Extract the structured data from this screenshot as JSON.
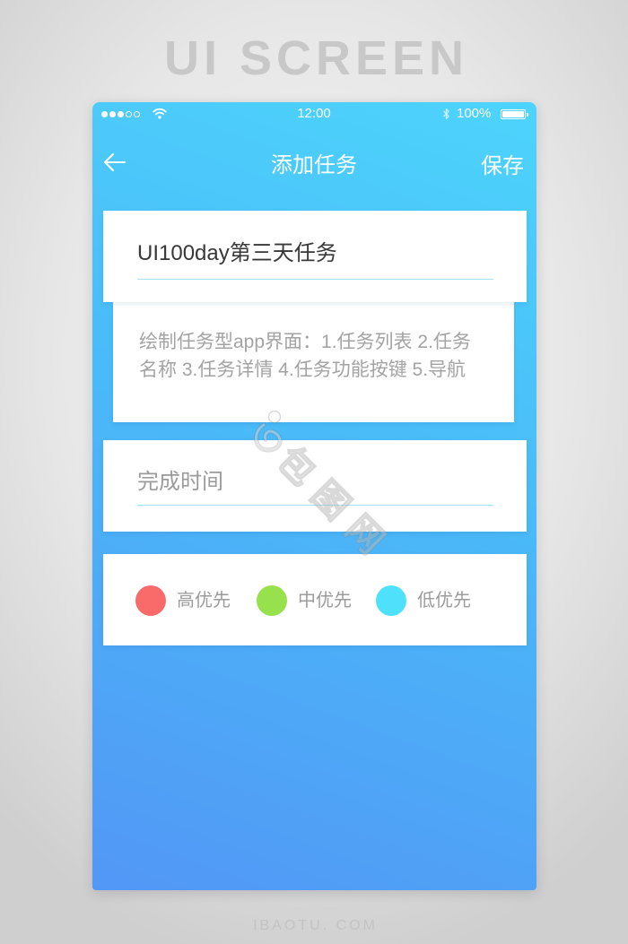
{
  "banner": {
    "title": "UI SCREEN"
  },
  "status_bar": {
    "signal_filled": 3,
    "signal_icon": "signal-dots-icon",
    "wifi_icon": "wifi-icon",
    "time": "12:00",
    "bluetooth_icon": "bluetooth-icon",
    "battery_text": "100%",
    "battery_icon": "battery-icon",
    "battery_level": 1.0
  },
  "nav": {
    "back_icon": "back-arrow-icon",
    "title": "添加任务",
    "save_label": "保存"
  },
  "form": {
    "task_name": "UI100day第三天任务",
    "description_lines": [
      "绘制任务型app界面：1.任务列表 2.任务",
      "名称 3.任务详情 4.任务功能按键 5.导航"
    ],
    "due_time_placeholder": "完成时间"
  },
  "priority": {
    "options": [
      {
        "label": "高优先",
        "color": "#f96b6b"
      },
      {
        "label": "中优先",
        "color": "#96e14c"
      },
      {
        "label": "低优先",
        "color": "#4fe1fb"
      }
    ]
  },
  "colors": {
    "screen_gradient": [
      "#4dd4fc",
      "#4abaf8",
      "#5297f6"
    ],
    "field_underline": "#a5e3f5",
    "text_primary": "#383838",
    "text_muted": "#9b9b9b"
  },
  "watermark": {
    "text": "包图网"
  },
  "footer": {
    "site": "IBAOTU. COM"
  }
}
